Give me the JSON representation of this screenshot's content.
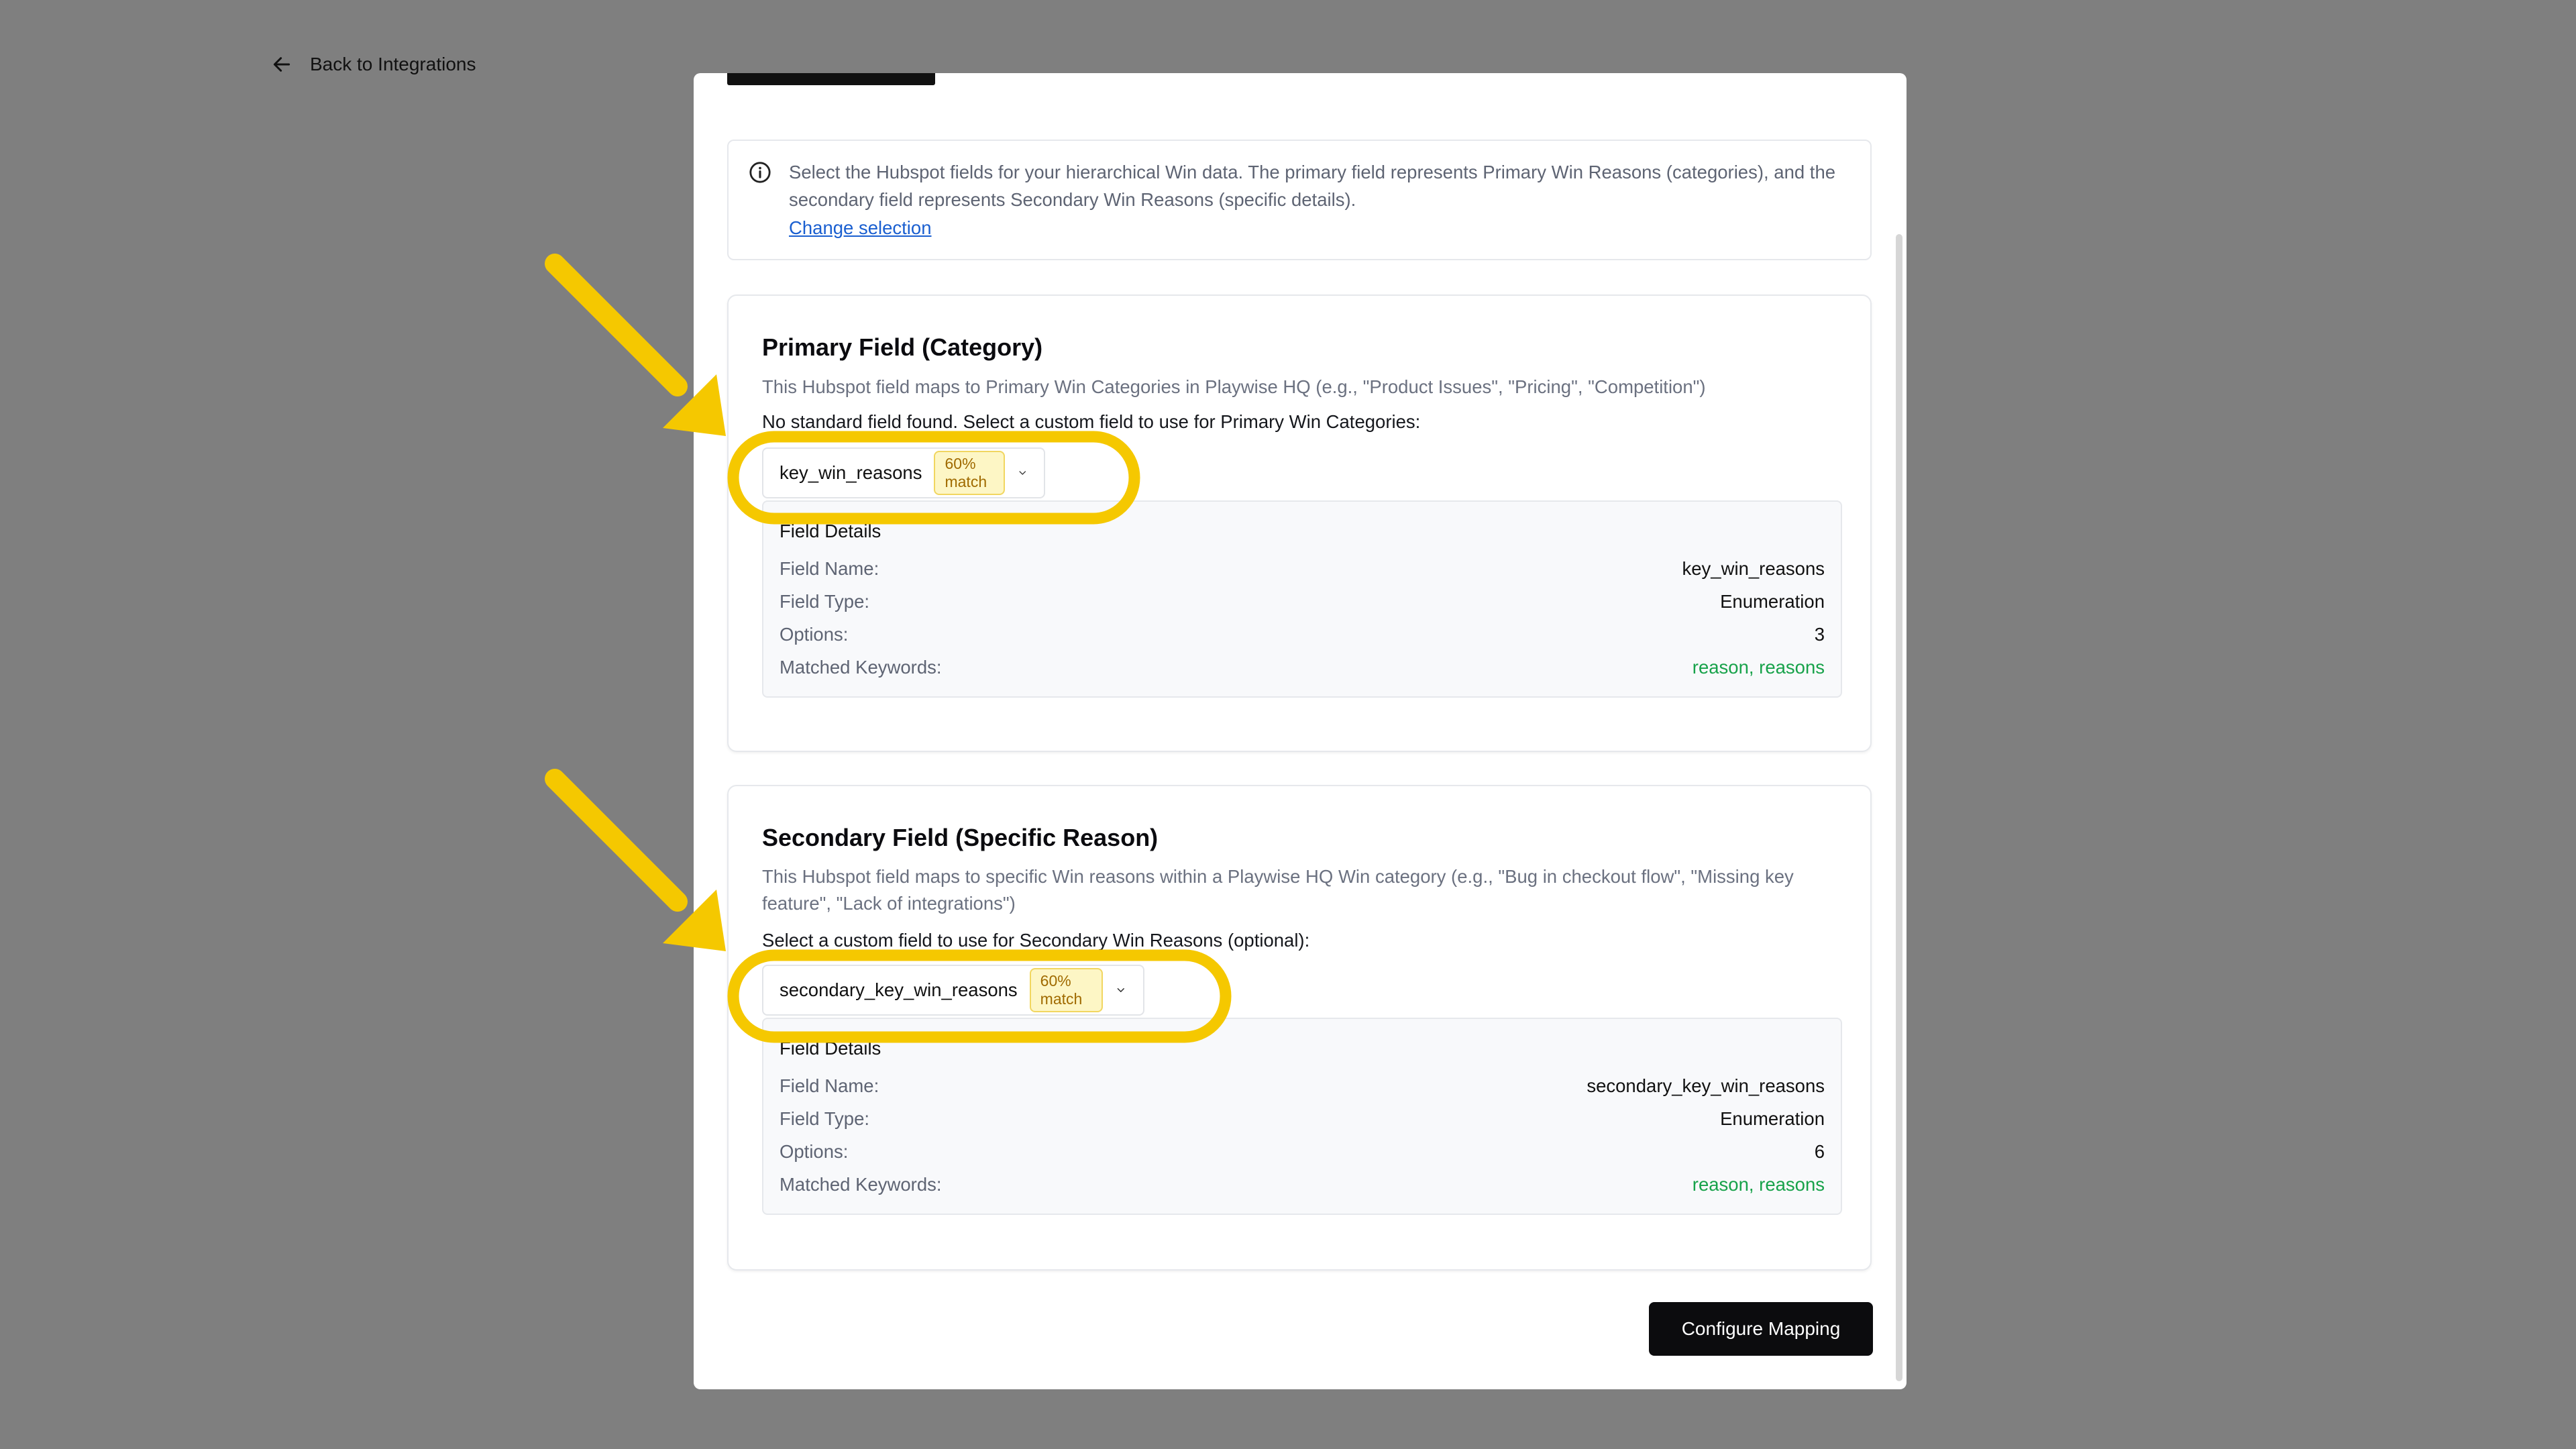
{
  "nav": {
    "back_label": "Back to Integrations"
  },
  "info": {
    "text": "Select the Hubspot fields for your hierarchical Win data. The primary field represents Primary Win Reasons (categories), and the secondary field represents Secondary Win Reasons (specific details).",
    "change_link": "Change selection"
  },
  "primary": {
    "title": "Primary Field (Category)",
    "description": "This Hubspot field maps to Primary Win Categories in Playwise HQ (e.g., \"Product Issues\", \"Pricing\", \"Competition\")",
    "prompt": "No standard field found. Select a custom field to use for Primary Win Categories:",
    "selected_value": "key_win_reasons",
    "match_badge": "60% match",
    "details": {
      "title": "Field Details",
      "rows": [
        {
          "label": "Field Name:",
          "value": "key_win_reasons"
        },
        {
          "label": "Field Type:",
          "value": "Enumeration"
        },
        {
          "label": "Options:",
          "value": "3"
        },
        {
          "label": "Matched Keywords:",
          "value": "reason, reasons"
        }
      ]
    }
  },
  "secondary": {
    "title": "Secondary Field (Specific Reason)",
    "description": "This Hubspot field maps to specific Win reasons within a Playwise HQ Win category (e.g., \"Bug in checkout flow\", \"Missing key feature\", \"Lack of integrations\")",
    "prompt": "Select a custom field to use for Secondary Win Reasons (optional):",
    "selected_value": "secondary_key_win_reasons",
    "match_badge": "60% match",
    "details": {
      "title": "Field Details",
      "rows": [
        {
          "label": "Field Name:",
          "value": "secondary_key_win_reasons"
        },
        {
          "label": "Field Type:",
          "value": "Enumeration"
        },
        {
          "label": "Options:",
          "value": "6"
        },
        {
          "label": "Matched Keywords:",
          "value": "reason, reasons"
        }
      ]
    }
  },
  "footer": {
    "configure_label": "Configure Mapping"
  },
  "colors": {
    "backdrop": "#7f7f7f",
    "annotation": "#f5c800",
    "keyword_green": "#17a24a",
    "link_blue": "#1a5fd0",
    "badge_bg": "#fdf6c5"
  },
  "icons": [
    "arrow-left-icon",
    "info-icon",
    "chevron-down-icon"
  ]
}
